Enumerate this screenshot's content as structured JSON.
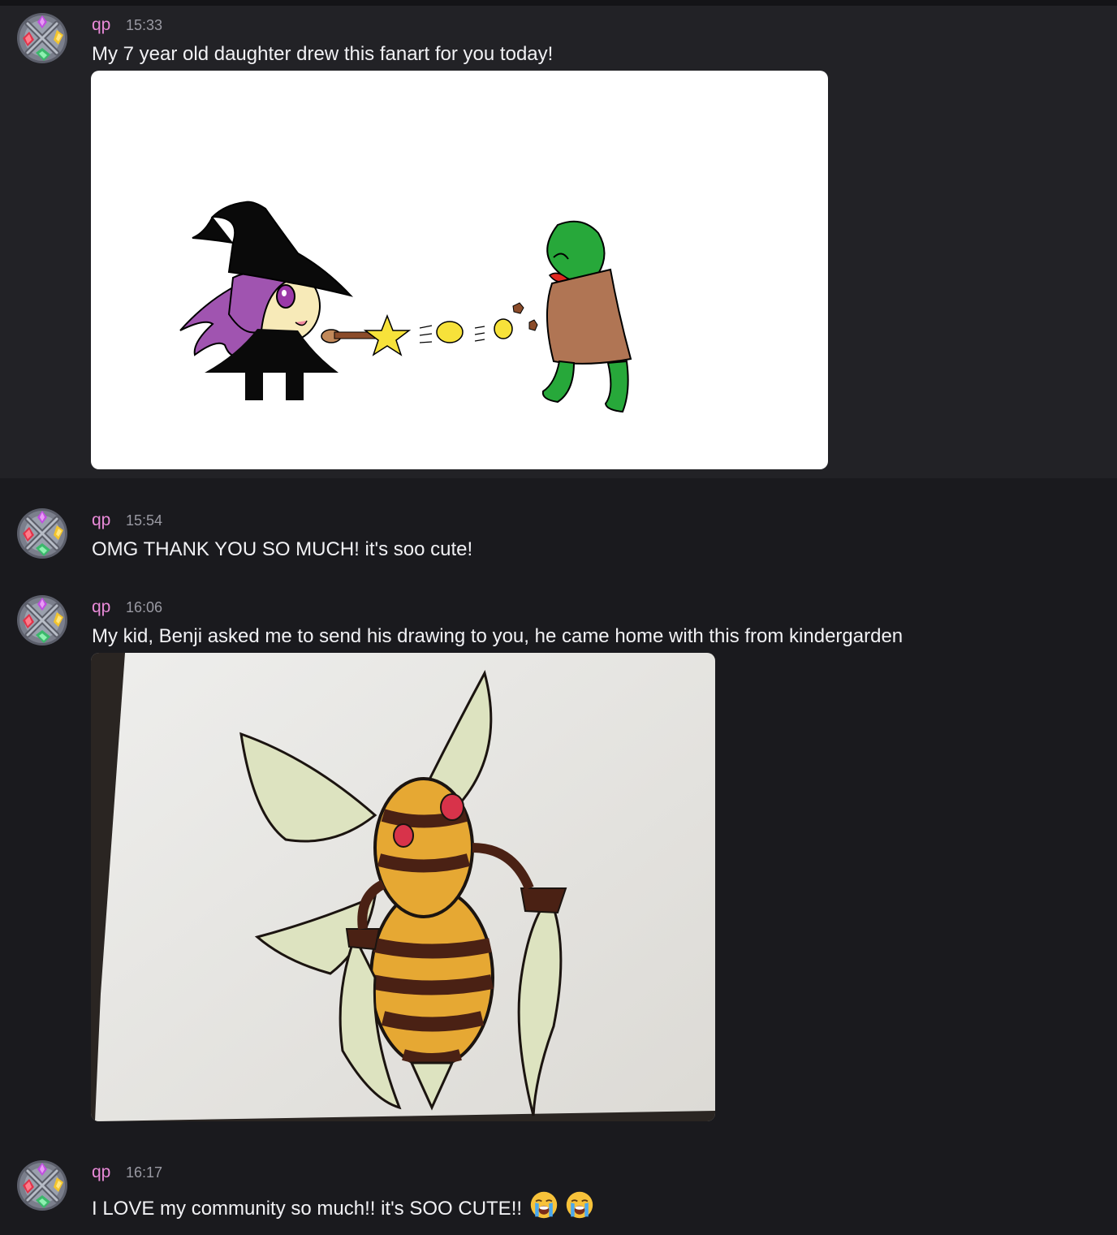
{
  "messages": [
    {
      "author": "qp",
      "time": "15:33",
      "text": "My 7 year old daughter drew this fanart for you today!"
    },
    {
      "author": "qp",
      "time": "15:54",
      "text": "OMG THANK YOU SO MUCH! it's soo cute!"
    },
    {
      "author": "qp",
      "time": "16:06",
      "text": "My kid, Benji asked me to send his drawing to you, he came home with this from kindergarden"
    },
    {
      "author": "qp",
      "time": "16:17",
      "text": "I LOVE my community so much!! it's SOO CUTE!!",
      "emojis": [
        "loudly-crying-face",
        "loudly-crying-face"
      ]
    }
  ],
  "colors": {
    "username": "#e98ad8",
    "timestamp": "#9a9aa3",
    "background": "#1a1a1e",
    "highlight": "#222226"
  },
  "icons": {
    "avatar": "crystal-emblem-avatar-icon",
    "emoji": "loudly-crying-face-icon"
  }
}
